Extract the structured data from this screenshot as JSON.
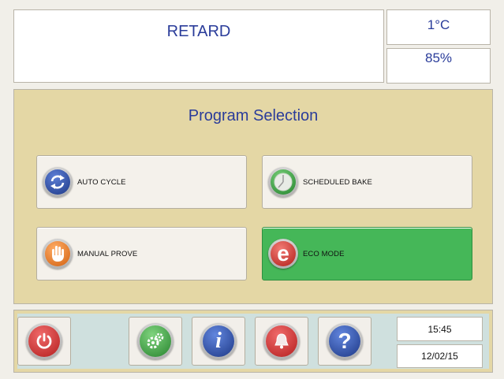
{
  "header": {
    "mode": "RETARD",
    "temperature": "1°C",
    "humidity": "85%"
  },
  "program": {
    "title": "Program Selection",
    "buttons": [
      {
        "label": "AUTO CYCLE",
        "icon": "refresh-arrows-icon",
        "color": "#2d4fa8"
      },
      {
        "label": "SCHEDULED BAKE",
        "icon": "clock-icon",
        "color": "#3aa340"
      },
      {
        "label": "MANUAL PROVE",
        "icon": "hand-icon",
        "color": "#ee7a1f"
      },
      {
        "label": "ECO MODE",
        "icon": "eco-e-icon",
        "color": "#d63a35",
        "active": true
      }
    ]
  },
  "toolbar": {
    "buttons": [
      {
        "name": "power-button",
        "icon": "power-icon",
        "color": "#d83b3b"
      },
      {
        "name": "settings-button",
        "icon": "gears-icon",
        "color": "#3ea548"
      },
      {
        "name": "info-button",
        "icon": "info-icon",
        "color": "#2d4fa8"
      },
      {
        "name": "alarm-button",
        "icon": "bell-icon",
        "color": "#d83b3b"
      },
      {
        "name": "help-button",
        "icon": "question-icon",
        "color": "#2d4fa8"
      }
    ],
    "time": "15:45",
    "date": "12/02/15"
  },
  "colors": {
    "panel": "#e4d7a5",
    "active": "#45b758",
    "text_blue": "#2a3c9a"
  }
}
